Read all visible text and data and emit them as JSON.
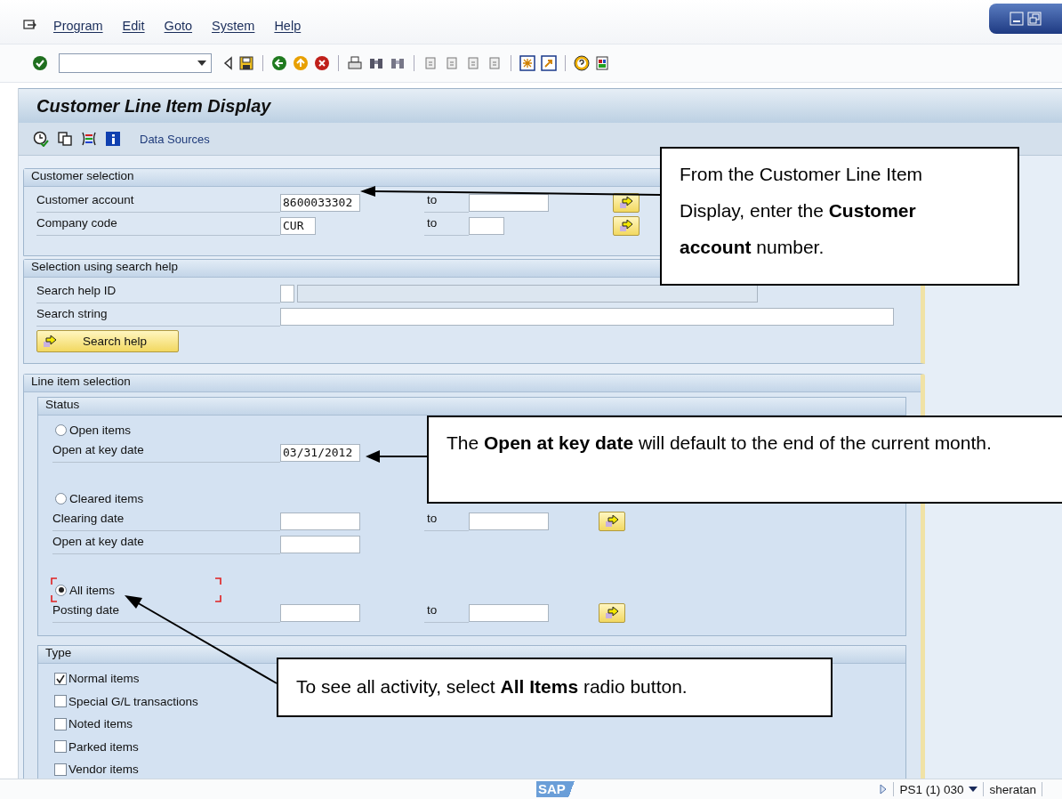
{
  "menu": [
    {
      "label": "Program"
    },
    {
      "label": "Edit"
    },
    {
      "label": "Goto"
    },
    {
      "label": "System"
    },
    {
      "label": "Help"
    }
  ],
  "title": "Customer Line Item Display",
  "app_toolbar": {
    "button": "Data Sources"
  },
  "customer_selection": {
    "title": "Customer selection",
    "rows": [
      {
        "label": "Customer account",
        "value": "8600033302",
        "to_label": "to",
        "short": false
      },
      {
        "label": "Company code",
        "value": "CUR",
        "to_label": "to",
        "short": true
      }
    ]
  },
  "search_help": {
    "title": "Selection using search help",
    "id_label": "Search help ID",
    "string_label": "Search string",
    "button": "Search help"
  },
  "line_item_selection": {
    "title": "Line item selection",
    "status": {
      "title": "Status",
      "groups": [
        {
          "option": {
            "label": "Open items",
            "selected": false,
            "focused": false
          },
          "rows": [
            {
              "label": "Open at key date",
              "value": "03/31/2012"
            }
          ]
        },
        {
          "option": {
            "label": "Cleared items",
            "selected": false,
            "focused": false
          },
          "rows": [
            {
              "label": "Clearing date",
              "to_label": "to"
            },
            {
              "label": "Open at key date"
            }
          ]
        },
        {
          "option": {
            "label": "All items",
            "selected": true,
            "focused": true
          },
          "rows": [
            {
              "label": "Posting date",
              "to_label": "to"
            }
          ]
        }
      ]
    },
    "type": {
      "title": "Type",
      "items": [
        {
          "label": "Normal items",
          "checked": true
        },
        {
          "label": "Special G/L transactions",
          "checked": false
        },
        {
          "label": "Noted items",
          "checked": false
        },
        {
          "label": "Parked items",
          "checked": false
        },
        {
          "label": "Vendor items",
          "checked": false
        }
      ]
    }
  },
  "status_bar": {
    "logo": "SAP",
    "system": "PS1 (1) 030",
    "user": "sheratan"
  },
  "callouts": [
    {
      "text": "From the Customer Line Item Display, enter the **Customer account** number."
    },
    {
      "text": "The **Open at key date** will default to the end of the current month."
    },
    {
      "text": "To see all activity, select **All Items** radio button."
    }
  ]
}
